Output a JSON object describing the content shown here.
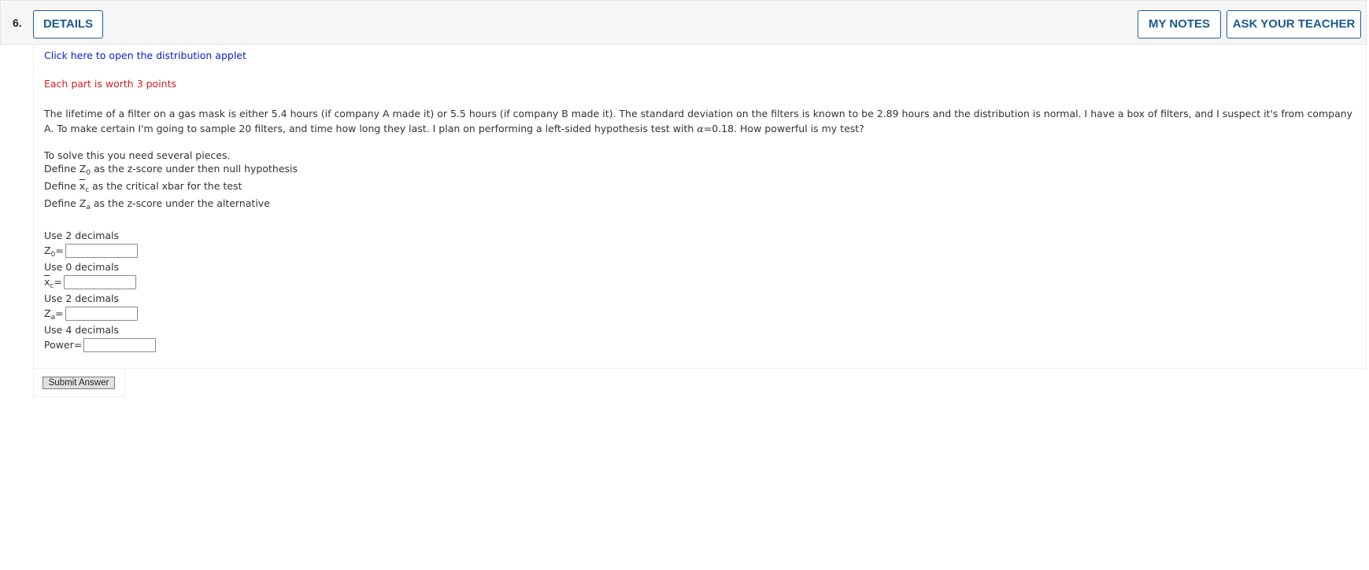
{
  "header": {
    "question_number": "6.",
    "details_label": "DETAILS",
    "my_notes_label": "MY NOTES",
    "ask_teacher_label": "ASK YOUR TEACHER"
  },
  "applet_link": "Click here to open the distribution applet",
  "points_note": "Each part is worth 3 points",
  "problem_text": "The lifetime of a filter on a gas mask is either 5.4 hours (if company A made it) or 5.5 hours (if company B made it). The standard deviation on the filters is known to be 2.89 hours and the distribution is normal. I have a box of filters, and I suspect it's from company A. To make certain I'm going to sample 20 filters, and time how long they last. I plan on performing a left-sided hypothesis test with",
  "alpha_symbol": "α",
  "alpha_value": "=0.18. How powerful is my test?",
  "instructions": {
    "intro": "To solve this you need several pieces.",
    "define_prefix": "Define",
    "z0_letter": "Z",
    "z0_sub": "0",
    "z0_desc": "as the z-score under then null hypothesis",
    "xc_letter": "x",
    "xc_sub": "c",
    "xc_desc": "as the critical xbar for the test",
    "za_letter": "Z",
    "za_sub": "a",
    "za_desc": "as the z-score under the alternative"
  },
  "fields": {
    "z0_hint": "Use 2 decimals",
    "z0_value": "",
    "xc_hint": "Use 0 decimals",
    "xc_value": "",
    "za_hint": "Use 2 decimals",
    "za_value": "",
    "power_hint": "Use 4 decimals",
    "power_label": "Power=",
    "power_value": "",
    "equals": "="
  },
  "submit_label": "Submit Answer"
}
